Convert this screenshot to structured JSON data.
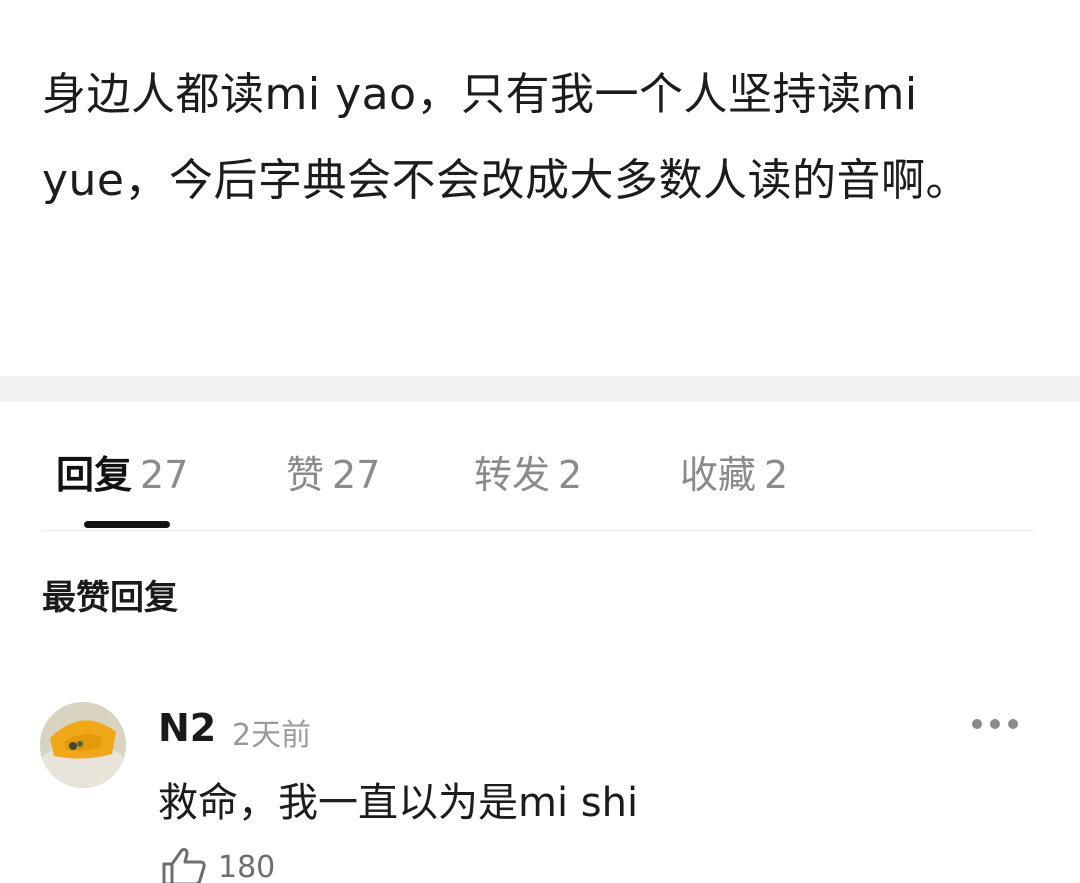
{
  "post": {
    "body": "身边人都读mi yao，只有我一个人坚持读mi yue，今后字典会不会改成大多数人读的音啊。"
  },
  "tabs": [
    {
      "label": "回复",
      "count": "27",
      "active": true
    },
    {
      "label": "赞",
      "count": "27",
      "active": false
    },
    {
      "label": "转发",
      "count": "2",
      "active": false
    },
    {
      "label": "收藏",
      "count": "2",
      "active": false
    }
  ],
  "section_title": "最赞回复",
  "comments": [
    {
      "user": "N2",
      "time": "2天前",
      "text": "救命，我一直以为是mi shi",
      "likes": "180",
      "avatar_icon": "avatar-image"
    }
  ],
  "icons": {
    "more": "more-dots-icon",
    "like": "thumbs-up-icon"
  },
  "colors": {
    "text": "#1a1a1a",
    "muted": "#8a8a8a",
    "divider": "#f2f2f2",
    "indicator": "#111111"
  }
}
